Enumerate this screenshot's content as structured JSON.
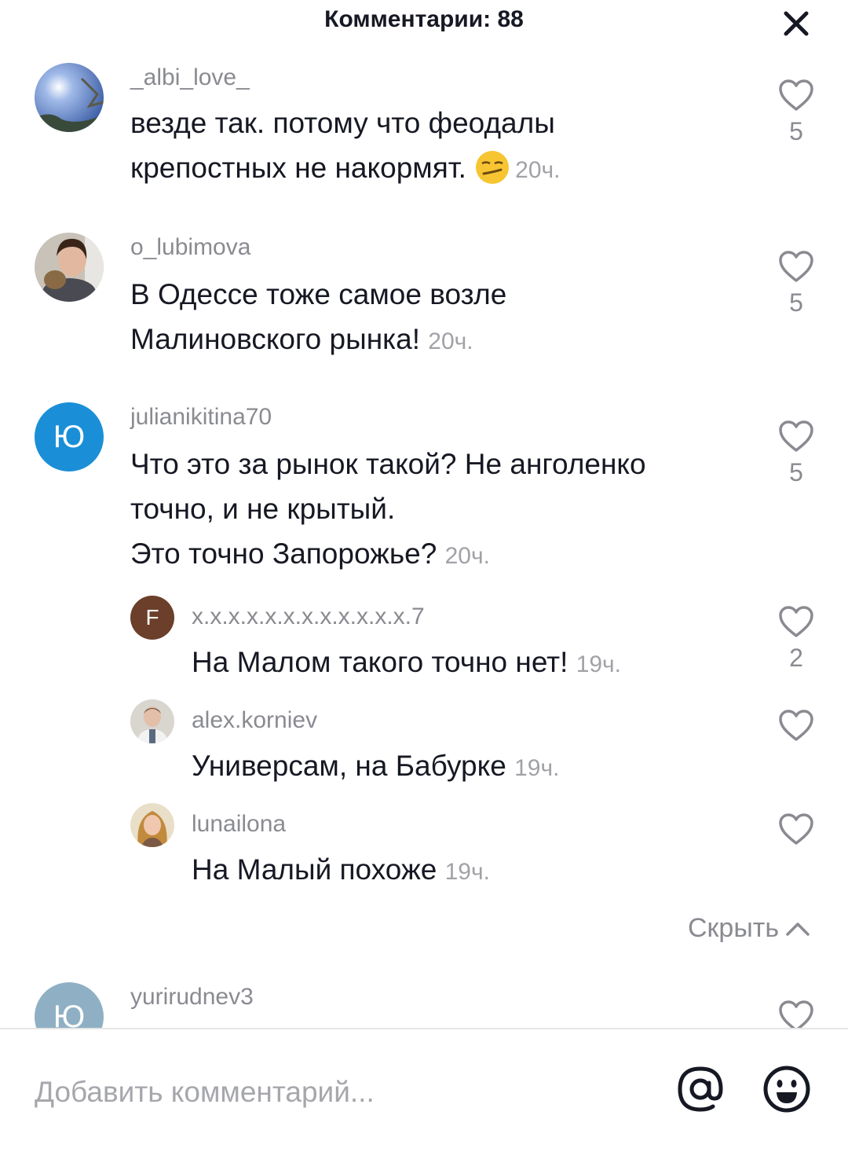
{
  "header": {
    "title": "Комментарии: 88"
  },
  "comments": [
    {
      "username": "_albi_love_",
      "lines": [
        "везде так. потому что феодалы",
        "крепостных не накормят."
      ],
      "time": "20ч.",
      "likes": "5"
    },
    {
      "username": "o_lubimova",
      "lines": [
        "В Одессе тоже самое возле",
        "Малиновского рынка!"
      ],
      "time": "20ч.",
      "likes": "5"
    },
    {
      "username": "julianikitina70",
      "avatar_letter": "Ю",
      "lines": [
        "Что это за рынок такой? Не анголенко",
        "точно, и не крытый.",
        "Это точно Запорожье?"
      ],
      "time": "20ч.",
      "likes": "5"
    }
  ],
  "replies": [
    {
      "username": "x.x.x.x.x.x.x.x.x.x.x.x.7",
      "avatar_letter": "F",
      "text": "На Малом такого точно нет!",
      "time": "19ч.",
      "likes": "2"
    },
    {
      "username": "alex.korniev",
      "text": "Универсам, на Бабурке",
      "time": "19ч."
    },
    {
      "username": "lunailona",
      "text": "На Малый похоже",
      "time": "19ч."
    }
  ],
  "hide_label": "Скрыть",
  "partial_comment": {
    "username": "yurirudnev3",
    "avatar_letter": "Ю"
  },
  "input": {
    "placeholder": "Добавить комментарий..."
  },
  "colors": {
    "blue_avatar": "#1a8fd8",
    "brown_avatar": "#6b3f2a",
    "faded_avatar": "#8fb0c4"
  },
  "icons": [
    "close-icon",
    "heart-outline-icon",
    "chevron-up-icon",
    "at-sign-icon",
    "emoji-icon",
    "smirk-emoji"
  ]
}
